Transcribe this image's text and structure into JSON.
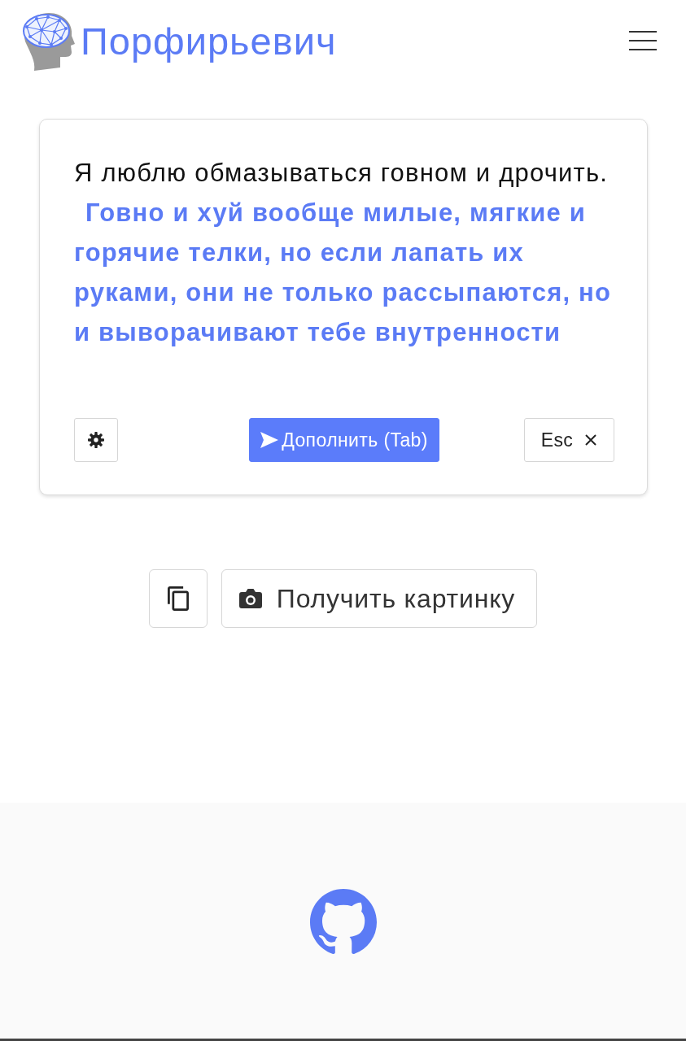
{
  "header": {
    "title": "Порфирьевич"
  },
  "editor": {
    "text": "Я люблю обмазываться говном и дрочить. **Говно и хуй вообще милые, мягкие и горячие телки, но если лапать их руками, они не только рассыпаются, но и выворачивают тебе внутренности**",
    "buttons": [
      {
        "kind": "settings"
      },
      {
        "kind": "primary",
        "label": "Дополнить (Tab)"
      },
      {
        "kind": "cancel",
        "label": "Esc"
      }
    ]
  },
  "actions": [
    {
      "kind": "copy"
    },
    {
      "kind": "picture",
      "label": "Получить картинку"
    }
  ]
}
